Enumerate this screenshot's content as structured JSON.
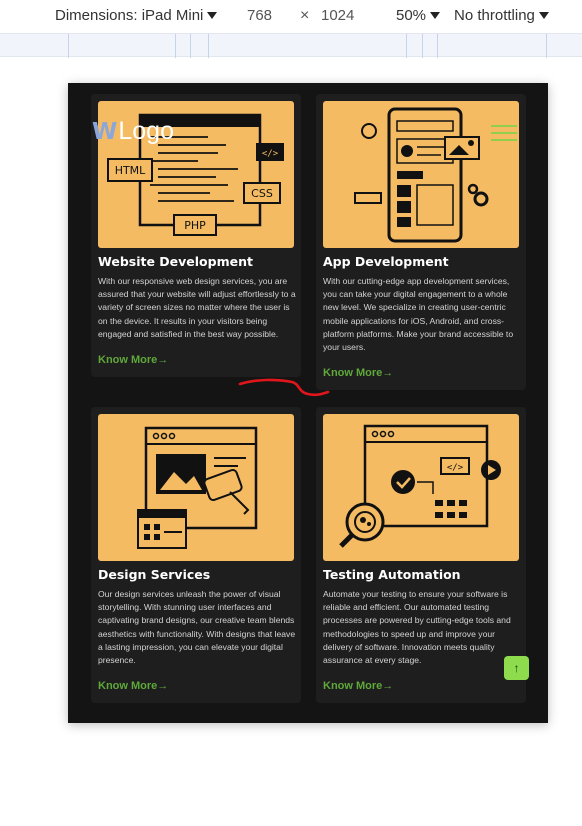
{
  "devtools": {
    "dimensions_label": "Dimensions: iPad Mini",
    "width": "768",
    "times": "×",
    "height": "1024",
    "zoom": "50%",
    "throttling": "No throttling"
  },
  "site": {
    "logo_text": "Logo",
    "logo_mark": "W",
    "scroll_top_icon": "↑"
  },
  "cards": [
    {
      "title": "Website Development",
      "text": "With our responsive web design services, you are assured that your website will adjust effortlessly to a variety of screen sizes no matter where the user is on the device. It results in your visitors being engaged and satisfied in the best way possible.",
      "link": "Know More",
      "illustration": "web-code-illustration",
      "labels": [
        "HTML",
        "CSS",
        "PHP",
        "</>"
      ]
    },
    {
      "title": "App Development",
      "text": "With our cutting-edge app development services, you can take your digital engagement to a whole new level. We specialize in creating user-centric mobile applications for iOS, Android, and cross-platform platforms. Make your brand accessible to your users.",
      "link": "Know More",
      "illustration": "mobile-app-illustration"
    },
    {
      "title": "Design Services",
      "text": "Our design services unleash the power of visual storytelling. With stunning user interfaces and captivating brand designs, our creative team blends aesthetics with functionality. With designs that leave a lasting impression, you can elevate your digital presence.",
      "link": "Know More",
      "illustration": "design-tools-illustration"
    },
    {
      "title": "Testing Automation",
      "text": "Automate your testing to ensure your software is reliable and efficient. Our automated testing processes are powered by cutting-edge tools and methodologies to speed up and improve your delivery of software. Innovation meets quality assurance at every stage.",
      "link": "Know More",
      "illustration": "testing-automation-illustration",
      "labels": [
        "</>"
      ]
    }
  ],
  "colors": {
    "card_image_bg": "#f4bb63",
    "page_bg": "#141414",
    "card_bg": "#1e1e1e",
    "link_green": "#5fa83a",
    "annotation_red": "#e0161b"
  }
}
